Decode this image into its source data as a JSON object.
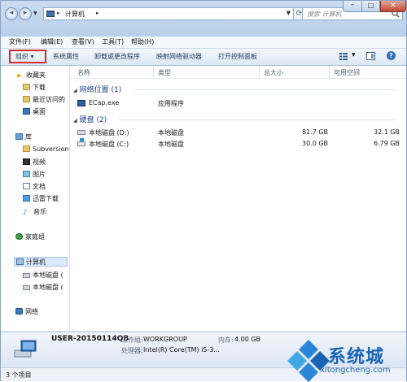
{
  "window": {
    "address": {
      "location": "计算机",
      "separator": "▸"
    },
    "search": {
      "placeholder": "搜索 计算机"
    },
    "controls": {
      "minimize": "–",
      "maximize": "□",
      "close": "✕"
    }
  },
  "menubar": {
    "items": [
      "文件(F)",
      "编辑(E)",
      "查看(V)",
      "工具(T)",
      "帮助(H)"
    ]
  },
  "toolbar": {
    "organize": "组织 ▾",
    "system_properties": "系统属性",
    "uninstall": "卸载或更改程序",
    "map_drive": "映射网络驱动器",
    "control_panel": "打开控制面板",
    "help": "?"
  },
  "sidebar": {
    "favorites": "收藏夹",
    "downloads": "下载",
    "recent": "最近访问的",
    "desktop": "桌面",
    "library": "库",
    "subversion": "Subversion",
    "videos": "视频",
    "pictures": "图片",
    "documents": "文档",
    "thunder": "迅雷下载",
    "music": "音乐",
    "homegroup": "家庭组",
    "computer": "计算机",
    "drive_d": "本地磁盘 (",
    "drive_c": "本地磁盘 (",
    "network": "网络"
  },
  "columns": {
    "name": "名称",
    "type": "类型",
    "total": "总大小",
    "free": "可用空间"
  },
  "groups": {
    "network_locations": "网络位置 (1)",
    "hard_disks": "硬盘 (2)"
  },
  "items": {
    "ecap": {
      "name": "ECap.exe",
      "type": "应用程序"
    },
    "drive_d": {
      "name": "本地磁盘 (D:)",
      "type": "本地磁盘",
      "total": "81.7 GB",
      "free": "32.1 GB"
    },
    "drive_c": {
      "name": "本地磁盘 (C:)",
      "type": "本地磁盘",
      "total": "30.0 GB",
      "free": "6.79 GB"
    }
  },
  "details": {
    "computer_name": "USER-20150114QB",
    "workgroup_label": "工作组:",
    "workgroup": "WORKGROUP",
    "memory_label": "内存:",
    "memory": "4.00 GB",
    "processor_label": "处理器:",
    "processor": "Intel(R) Core(TM) i5-3..."
  },
  "status": {
    "count": "3 个项目"
  },
  "watermark": {
    "brand": "系统城",
    "url": "xitongcheng.com"
  },
  "colors": {
    "accent": "#1a62b4",
    "highlight": "#d22b2b"
  }
}
